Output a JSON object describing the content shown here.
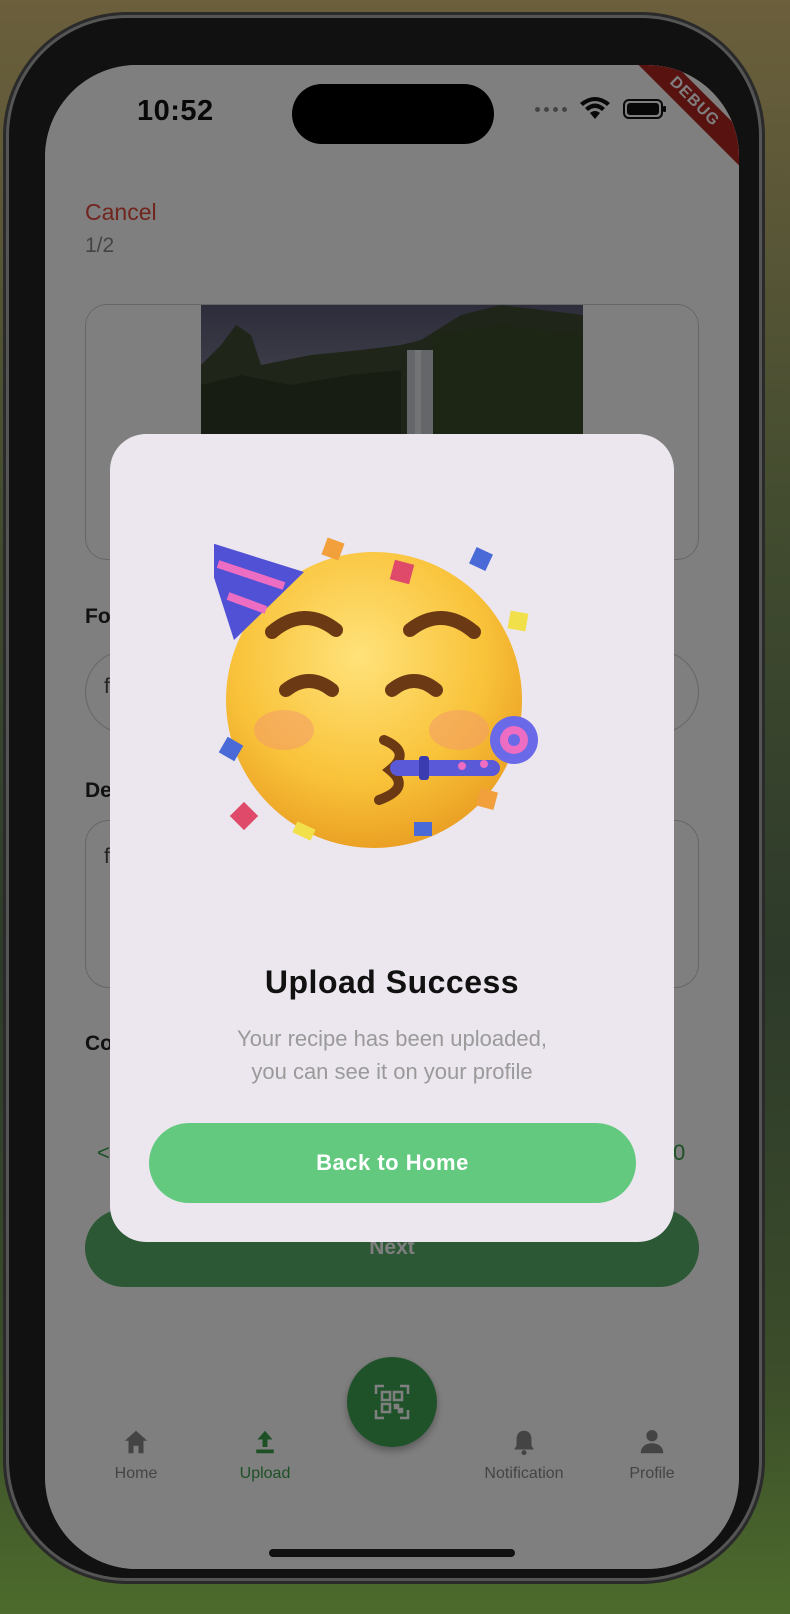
{
  "status_bar": {
    "time": "10:52",
    "debug_label": "DEBUG"
  },
  "page": {
    "cancel_label": "Cancel",
    "step_indicator": "1/2",
    "fields": [
      {
        "label": "Fo",
        "value": "f"
      },
      {
        "label": "De",
        "value": "f"
      },
      {
        "label": "Co"
      }
    ],
    "stepper_left": "<",
    "stepper_right": "0",
    "next_label": "Next"
  },
  "bottom_nav": {
    "items": [
      {
        "label": "Home",
        "icon": "home-icon"
      },
      {
        "label": "Upload",
        "icon": "upload-icon",
        "active": true
      },
      {
        "label": "Notification",
        "icon": "bell-icon"
      },
      {
        "label": "Profile",
        "icon": "person-icon"
      }
    ],
    "fab_icon": "qr-scan-icon"
  },
  "dialog": {
    "emoji": "partying-face",
    "title": "Upload Success",
    "message_line1": "Your recipe has been uploaded,",
    "message_line2": "you can see it on your profile",
    "button_label": "Back to Home"
  },
  "colors": {
    "accent_green": "#3fa552",
    "button_green": "#63c97e",
    "cancel_red": "#e04a3a",
    "dialog_bg": "#ece6ee"
  }
}
